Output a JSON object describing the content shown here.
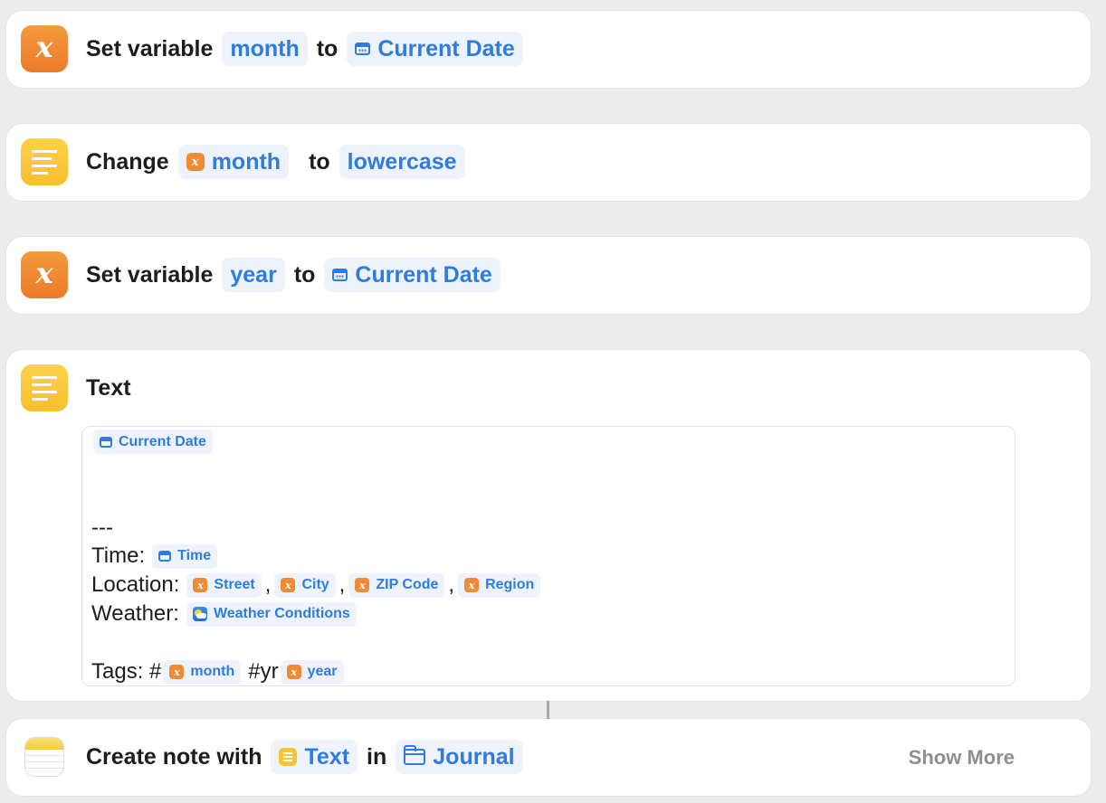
{
  "actions": {
    "set_month": {
      "label": "Set variable",
      "variable": "month",
      "to": "to",
      "value": "Current Date"
    },
    "change_case": {
      "label": "Change",
      "variable": "month",
      "to": "to",
      "value": "lowercase"
    },
    "set_year": {
      "label": "Set variable",
      "variable": "year",
      "to": "to",
      "value": "Current Date"
    },
    "text": {
      "label": "Text",
      "content": {
        "current_date": "Current Date",
        "separator": "---",
        "time_label": "Time:",
        "time_token": "Time",
        "location_label": "Location:",
        "street": "Street",
        "city": "City",
        "zip": "ZIP Code",
        "region": "Region",
        "comma": ",",
        "weather_label": "Weather:",
        "weather_token": "Weather Conditions",
        "tags_label": "Tags: #",
        "tag_month": "month",
        "tag_yr_prefix": "#yr",
        "tag_year": "year"
      }
    },
    "create_note": {
      "label": "Create note with",
      "input": "Text",
      "in": "in",
      "folder": "Journal",
      "show_more": "Show More"
    }
  },
  "colors": {
    "accent": "#2f7be0",
    "variable_orange": "#ef8a35",
    "text_yellow": "#f7c531",
    "background": "#ececec"
  },
  "icons": {
    "variable": "variable-x-icon",
    "text": "text-lines-icon",
    "notes": "notes-app-icon",
    "date": "calendar-icon",
    "folder": "folder-icon",
    "weather": "weather-icon"
  }
}
